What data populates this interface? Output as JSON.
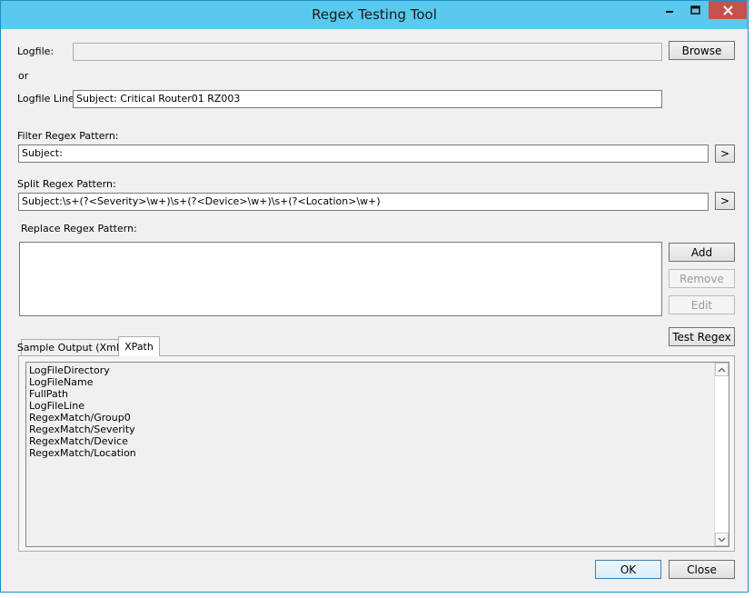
{
  "window": {
    "title": "Regex Testing Tool",
    "minimize_icon": "minimize-icon",
    "maximize_icon": "maximize-icon",
    "close_icon": "close-icon"
  },
  "logfile": {
    "label": "Logfile:",
    "value": "",
    "browse_label": "Browse"
  },
  "or_label": "or",
  "logfile_line": {
    "label": "Logfile Line:",
    "value": "Subject: Critical Router01 RZ003"
  },
  "filter": {
    "label": "Filter Regex Pattern:",
    "value": "Subject:",
    "button_label": ">"
  },
  "split": {
    "label": "Split Regex Pattern:",
    "value": "Subject:\\s+(?<Severity>\\w+)\\s+(?<Device>\\w+)\\s+(?<Location>\\w+)",
    "button_label": ">"
  },
  "replace": {
    "label": "Replace Regex Pattern:",
    "value": "",
    "add_label": "Add",
    "remove_label": "Remove",
    "edit_label": "Edit"
  },
  "test_regex_label": "Test Regex",
  "tabs": [
    {
      "label": "Sample Output (Xml)",
      "active": false
    },
    {
      "label": "XPath",
      "active": true
    }
  ],
  "xpath_items": [
    "LogFileDirectory",
    "LogFileName",
    "FullPath",
    "LogFileLine",
    "RegexMatch/Group0",
    "RegexMatch/Severity",
    "RegexMatch/Device",
    "RegexMatch/Location"
  ],
  "scroll_up_icon": "chevron-up-icon",
  "scroll_down_icon": "chevron-down-icon",
  "ok_label": "OK",
  "close_label": "Close"
}
